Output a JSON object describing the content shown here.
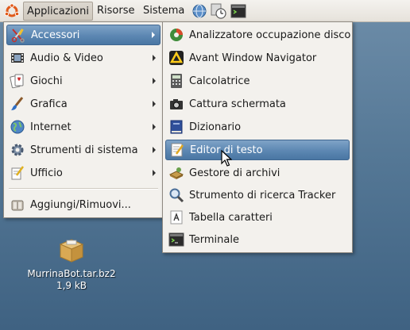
{
  "panel": {
    "applications": "Applicazioni",
    "places": "Risorse",
    "system": "Sistema",
    "icons": [
      "ubuntu-logo-icon",
      "globe-icon",
      "clock-icon",
      "terminal-icon"
    ]
  },
  "main_menu": {
    "items": [
      {
        "label": "Accessori",
        "icon": "scissors-pen-icon",
        "submenu": true,
        "highlighted": true
      },
      {
        "label": "Audio & Video",
        "icon": "film-icon",
        "submenu": true
      },
      {
        "label": "Giochi",
        "icon": "cards-icon",
        "submenu": true
      },
      {
        "label": "Grafica",
        "icon": "paintbrush-icon",
        "submenu": true
      },
      {
        "label": "Internet",
        "icon": "globe-icon",
        "submenu": true
      },
      {
        "label": "Strumenti di sistema",
        "icon": "gear-icon",
        "submenu": true
      },
      {
        "label": "Ufficio",
        "icon": "pen-doc-icon",
        "submenu": true
      }
    ],
    "extra": {
      "label": "Aggiungi/Rimuovi...",
      "icon": "package-icon"
    }
  },
  "accessories_menu": {
    "items": [
      {
        "label": "Analizzatore occupazione disco",
        "icon": "disk-usage-icon"
      },
      {
        "label": "Avant Window Navigator",
        "icon": "awn-icon"
      },
      {
        "label": "Calcolatrice",
        "icon": "calculator-icon"
      },
      {
        "label": "Cattura schermata",
        "icon": "camera-icon"
      },
      {
        "label": "Dizionario",
        "icon": "dictionary-icon"
      },
      {
        "label": "Editor di testo",
        "icon": "text-editor-icon",
        "highlighted": true
      },
      {
        "label": "Gestore di archivi",
        "icon": "archive-icon"
      },
      {
        "label": "Strumento di ricerca Tracker",
        "icon": "magnifier-icon"
      },
      {
        "label": "Tabella caratteri",
        "icon": "character-map-icon"
      },
      {
        "label": "Terminale",
        "icon": "terminal-icon"
      }
    ]
  },
  "desktop": {
    "file_name": "MurrinaBot.tar.bz2",
    "file_size": "1,9 kB"
  },
  "colors": {
    "highlight": "#5c87b2",
    "menu_bg": "#f3f1ed",
    "desktop": "#547795"
  }
}
